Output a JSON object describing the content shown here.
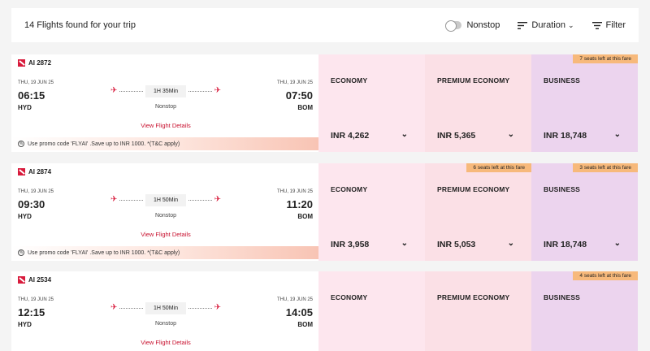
{
  "header": {
    "count_text": "14 Flights found for your trip",
    "nonstop_label": "Nonstop",
    "duration_label": "Duration",
    "filter_label": "Filter"
  },
  "flights": [
    {
      "flight_no": "AI 2872",
      "dep_date": "THU, 19 JUN 25",
      "dep_time": "06:15",
      "dep_city": "HYD",
      "arr_date": "THU, 19 JUN 25",
      "arr_time": "07:50",
      "arr_city": "BOM",
      "duration": "1H 35Min",
      "stops": "Nonstop",
      "details": "View Flight Details",
      "promo": "Use promo code 'FLYAI' .Save up to INR 1000. *(T&C apply)",
      "fares": {
        "economy": {
          "name": "ECONOMY",
          "price": "INR 4,262",
          "seats": ""
        },
        "premium": {
          "name": "PREMIUM ECONOMY",
          "price": "INR 5,365",
          "seats": ""
        },
        "business": {
          "name": "BUSINESS",
          "price": "INR 18,748",
          "seats": "7 seats left at this fare"
        }
      }
    },
    {
      "flight_no": "AI 2874",
      "dep_date": "THU, 19 JUN 25",
      "dep_time": "09:30",
      "dep_city": "HYD",
      "arr_date": "THU, 19 JUN 25",
      "arr_time": "11:20",
      "arr_city": "BOM",
      "duration": "1H 50Min",
      "stops": "Nonstop",
      "details": "View Flight Details",
      "promo": "Use promo code 'FLYAI' .Save up to INR 1000. *(T&C apply)",
      "fares": {
        "economy": {
          "name": "ECONOMY",
          "price": "INR 3,958",
          "seats": ""
        },
        "premium": {
          "name": "PREMIUM ECONOMY",
          "price": "INR 5,053",
          "seats": "6 seats left at this fare"
        },
        "business": {
          "name": "BUSINESS",
          "price": "INR 18,748",
          "seats": "3 seats left at this fare"
        }
      }
    },
    {
      "flight_no": "AI 2534",
      "dep_date": "THU, 19 JUN 25",
      "dep_time": "12:15",
      "dep_city": "HYD",
      "arr_date": "THU, 19 JUN 25",
      "arr_time": "14:05",
      "arr_city": "BOM",
      "duration": "1H 50Min",
      "stops": "Nonstop",
      "details": "View Flight Details",
      "fares": {
        "economy": {
          "name": "ECONOMY"
        },
        "premium": {
          "name": "PREMIUM ECONOMY"
        },
        "business": {
          "name": "BUSINESS",
          "seats": "4 seats left at this fare"
        }
      }
    }
  ],
  "icons": {
    "nonstop_toggle": "toggle-icon",
    "sort": "sort-icon",
    "filter": "filter-icon",
    "airline": "air-india-logo-icon",
    "takeoff": "takeoff-icon",
    "landing": "landing-icon",
    "promo": "promo-tag-icon",
    "expand": "chevron-down-icon"
  },
  "colors": {
    "brand": "#d81b3c",
    "economy_bg": "#fde6ee",
    "premium_bg": "#fbe0e6",
    "business_bg": "#ecd4ee",
    "seats_badge": "#f7b97b"
  }
}
